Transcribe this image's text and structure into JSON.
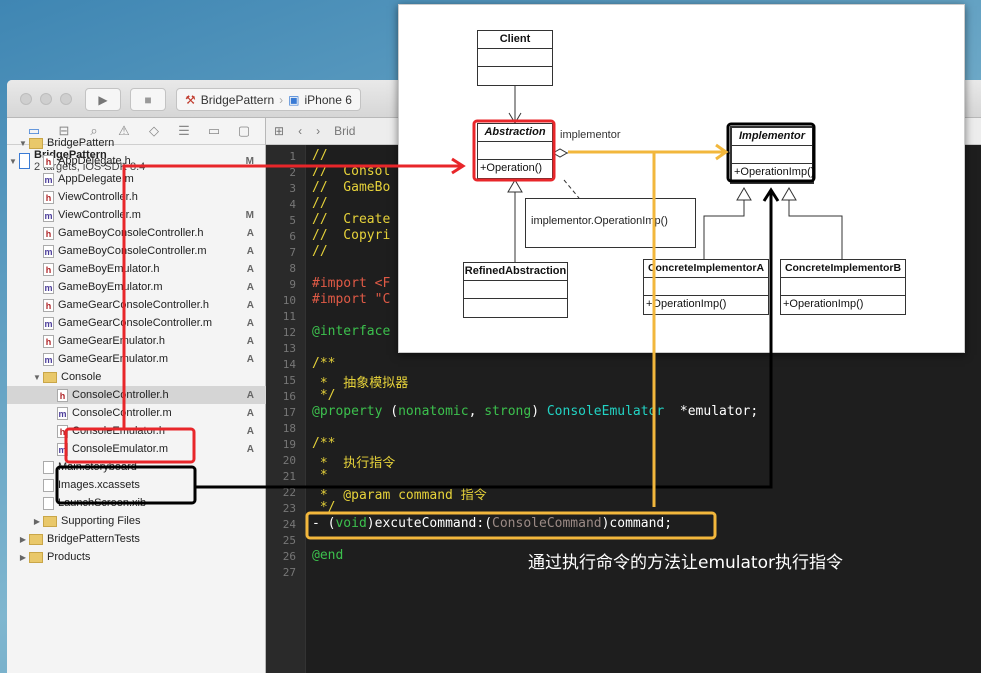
{
  "toolbar": {
    "scheme": "BridgePattern",
    "device": "iPhone 6",
    "run": "▶",
    "stop": "■"
  },
  "navigator": {
    "tabs": [
      "folder-icon",
      "hierarchy-icon",
      "search-icon",
      "warning-icon",
      "breakpoint-icon",
      "list-icon",
      "tag-icon",
      "chat-icon"
    ],
    "project": {
      "name": "BridgePattern",
      "subtitle": "2 targets, iOS SDK 8.4",
      "status": "M"
    },
    "items": [
      {
        "label": "BridgePattern",
        "type": "folder",
        "depth": 1,
        "open": true
      },
      {
        "label": "AppDelegate.h",
        "type": "h",
        "depth": 2,
        "status": ""
      },
      {
        "label": "AppDelegate.m",
        "type": "m",
        "depth": 2,
        "status": ""
      },
      {
        "label": "ViewController.h",
        "type": "h",
        "depth": 2,
        "status": ""
      },
      {
        "label": "ViewController.m",
        "type": "m",
        "depth": 2,
        "status": "M"
      },
      {
        "label": "GameBoyConsoleController.h",
        "type": "h",
        "depth": 2,
        "status": "A"
      },
      {
        "label": "GameBoyConsoleController.m",
        "type": "m",
        "depth": 2,
        "status": "A"
      },
      {
        "label": "GameBoyEmulator.h",
        "type": "h",
        "depth": 2,
        "status": "A"
      },
      {
        "label": "GameBoyEmulator.m",
        "type": "m",
        "depth": 2,
        "status": "A"
      },
      {
        "label": "GameGearConsoleController.h",
        "type": "h",
        "depth": 2,
        "status": "A"
      },
      {
        "label": "GameGearConsoleController.m",
        "type": "m",
        "depth": 2,
        "status": "A"
      },
      {
        "label": "GameGearEmulator.h",
        "type": "h",
        "depth": 2,
        "status": "A"
      },
      {
        "label": "GameGearEmulator.m",
        "type": "m",
        "depth": 2,
        "status": "A"
      },
      {
        "label": "Console",
        "type": "folder",
        "depth": 2,
        "open": true
      },
      {
        "label": "ConsoleController.h",
        "type": "h",
        "depth": 3,
        "status": "A",
        "selected": true
      },
      {
        "label": "ConsoleController.m",
        "type": "m",
        "depth": 3,
        "status": "A"
      },
      {
        "label": "ConsoleEmulator.h",
        "type": "h",
        "depth": 3,
        "status": "A"
      },
      {
        "label": "ConsoleEmulator.m",
        "type": "m",
        "depth": 3,
        "status": "A"
      },
      {
        "label": "Main.storyboard",
        "type": "f",
        "depth": 2,
        "status": ""
      },
      {
        "label": "Images.xcassets",
        "type": "f",
        "depth": 2,
        "status": ""
      },
      {
        "label": "LaunchScreen.xib",
        "type": "f",
        "depth": 2,
        "status": ""
      },
      {
        "label": "Supporting Files",
        "type": "folder",
        "depth": 2,
        "open": false
      },
      {
        "label": "BridgePatternTests",
        "type": "folder",
        "depth": 1,
        "open": false
      },
      {
        "label": "Products",
        "type": "folder",
        "depth": 1,
        "open": false
      }
    ]
  },
  "jumpbar": {
    "crumb": "Brid"
  },
  "code": [
    "<c>//</c>",
    "<c>//  Consol</c>",
    "<c>//  GameBo</c>",
    "<c>//</c>",
    "<c>//  Create</c>",
    "<c>//  Copyri</c>",
    "<c>//</c>",
    "",
    "<r>#import <F</r>",
    "<r>#import \"C</r>",
    "",
    "<k>@interface</k>",
    "",
    "<c>/**</c>",
    "<c> *  抽象模拟器</c>",
    "<c> */</c>",
    "<k>@property</k> (<k>nonatomic</k>, <k>strong</k>) <t>ConsoleEmulator</t>  *emulator;",
    "",
    "<c>/**</c>",
    "<c> *  执行指令</c>",
    "<c> *</c>",
    "<c> *  @param command 指令</c>",
    "<c> */</c>",
    "- (<k>void</k>)excuteCommand:(<g>ConsoleCommand</g>)command;",
    "",
    "<k>@end</k>",
    ""
  ],
  "diagram": {
    "client": "Client",
    "abstraction": "Abstraction",
    "abstraction_op": "+Operation()",
    "assoc_label": "implementor",
    "implementor": "Implementor",
    "implementor_op": "+OperationImp()",
    "note": "implementor.OperationImp()",
    "refined": "RefinedAbstraction",
    "concreteA": "ConcreteImplementorA",
    "concreteA_op": "+OperationImp()",
    "concreteB": "ConcreteImplementorB",
    "concreteB_op": "+OperationImp()"
  },
  "annotation": {
    "caption": "通过执行命令的方法让emulator执行指令",
    "colors": {
      "red": "#e8262a",
      "yellow": "#f2b73c",
      "black": "#000000"
    }
  }
}
